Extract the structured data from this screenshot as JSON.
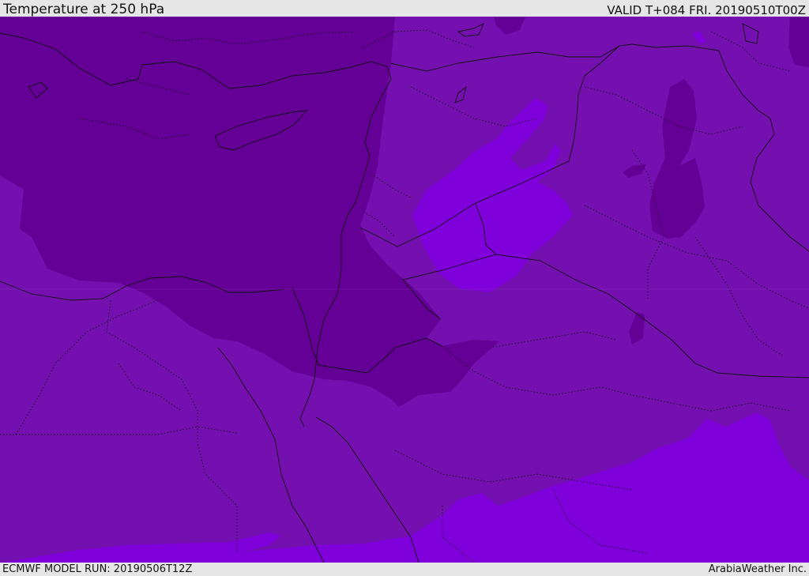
{
  "header": {
    "title": "Temperature at 250 hPa",
    "valid": "VALID T+084 FRI. 20190510T00Z"
  },
  "footer": {
    "model_run": "ECMWF MODEL RUN: 20190506T12Z",
    "credit": "ArabiaWeather Inc."
  },
  "colors": {
    "dark_purple": "#650096",
    "mid_purple": "#7510b0",
    "light_violet": "#8000dc",
    "boundary": "#111111"
  }
}
